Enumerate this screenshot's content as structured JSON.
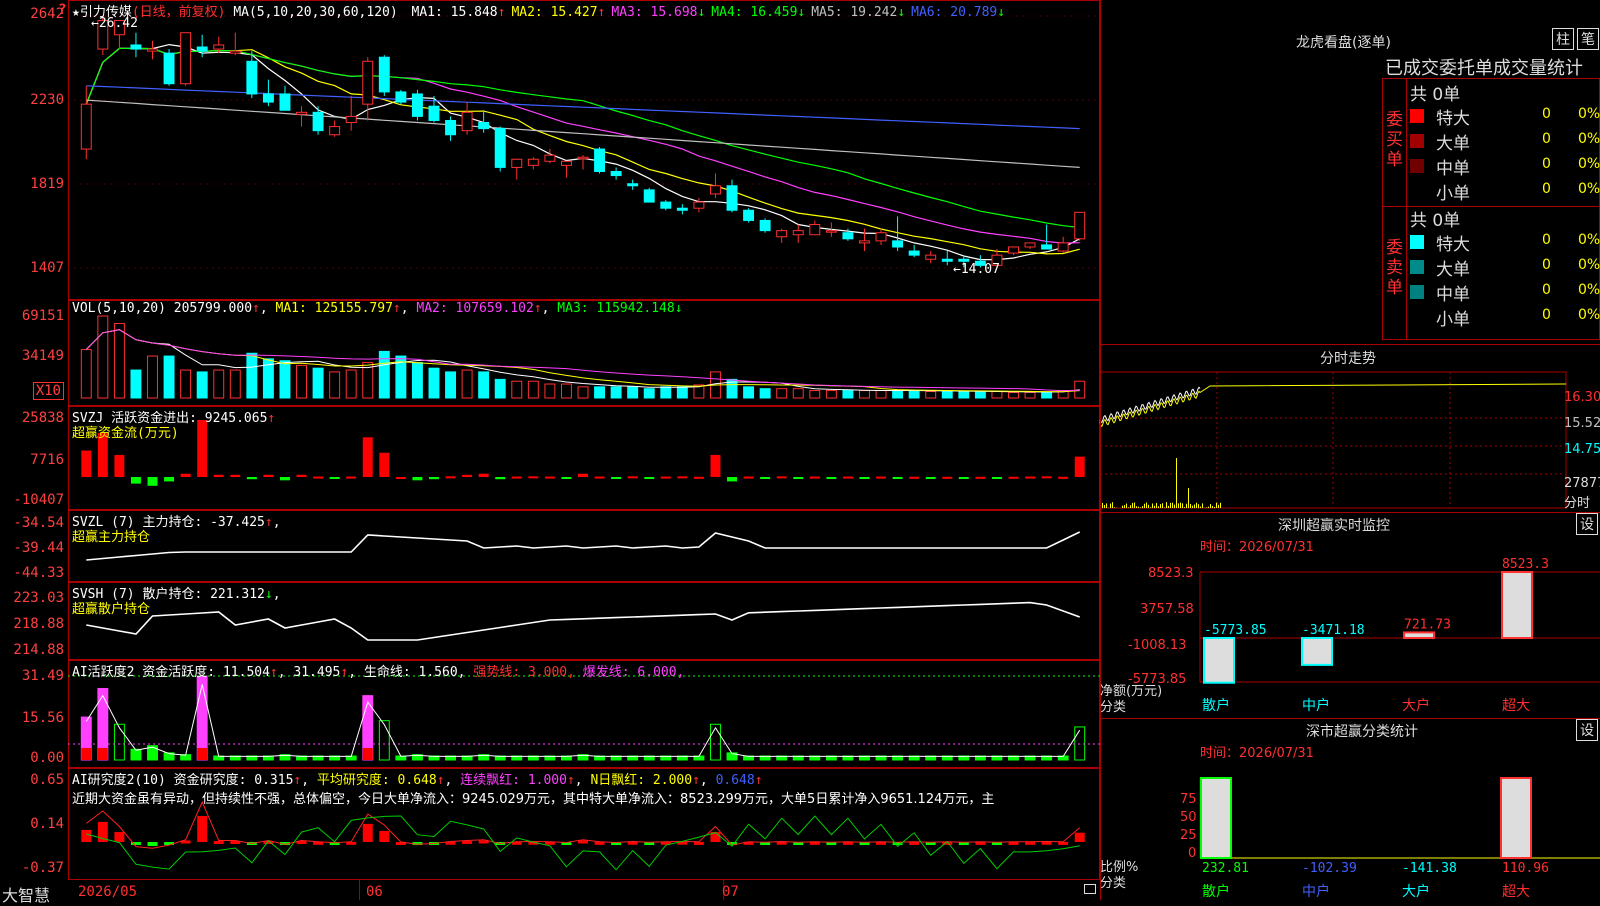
{
  "stock": {
    "name": "引力传媒",
    "mode": "(日线，前复权)",
    "ma_label": "MA(5,10,20,30,60,120)",
    "ma_values": [
      {
        "label": "MA1:",
        "value": "15.848",
        "arrow": "↑",
        "color": "#ffffff"
      },
      {
        "label": "MA2:",
        "value": "15.427",
        "arrow": "↑",
        "color": "#ffff00"
      },
      {
        "label": "MA3:",
        "value": "15.698",
        "arrow": "↓",
        "color": "#ff40ff"
      },
      {
        "label": "MA4:",
        "value": "16.459",
        "arrow": "↓",
        "color": "#00ff00"
      },
      {
        "label": "MA5:",
        "value": "19.242",
        "arrow": "↓",
        "color": "#c0c0c0"
      },
      {
        "label": "MA6:",
        "value": "20.789",
        "arrow": "↓",
        "color": "#4060ff"
      }
    ],
    "high_marker": "26.42",
    "low_marker": "14.07",
    "price_ticks": [
      "2642",
      "2230",
      "1819",
      "1407"
    ]
  },
  "vol": {
    "header": "VOL(5,10,20)",
    "value": "205799.000",
    "ma1": "MA1: 125155.797",
    "ma2": "MA2: 107659.102",
    "ma3": "MA3: 115942.148",
    "ticks": [
      "69151",
      "34149"
    ],
    "unit": "X10"
  },
  "svzj": {
    "header": "SVZJ  活跃资金进出: 9245.065",
    "sub": "超赢资金流(万元)",
    "ticks": [
      "25838",
      "7716",
      "-10407"
    ]
  },
  "svzl": {
    "header": "SVZL (7) 主力持仓: -37.425",
    "sub": "超赢主力持仓",
    "ticks": [
      "-34.54",
      "-39.44",
      "-44.33"
    ]
  },
  "svsh": {
    "header": "SVSH (7) 散户持仓: 221.312",
    "sub": "超赢散户持仓",
    "ticks": [
      "223.03",
      "218.88",
      "214.88"
    ]
  },
  "ai1": {
    "header": "AI活跃度2 资金活跃度: 11.504",
    "v2": "31.495",
    "life": "生命线: 1.560,",
    "strong": "强势线: 3.000,",
    "burst": "爆发线: 6.000,",
    "ticks": [
      "31.49",
      "15.56",
      "0.00"
    ]
  },
  "ai2": {
    "header": "AI研究度2(10) 资金研究度: 0.315",
    "avg": "平均研究度: 0.648",
    "cont": "连续飘红: 1.000",
    "nday": "N日飘红: 2.000",
    "last": "0.648",
    "text": "近期大资金虽有异动，但持续性不强，总体偏空，今日大单净流入：9245.029万元，其中特大单净流入：8523.299万元，大单5日累计净入9651.124万元，主",
    "ticks": [
      "0.65",
      "0.14",
      "-0.37"
    ]
  },
  "dates": [
    "2026/05",
    "06",
    "07"
  ],
  "logo": "大智慧",
  "right": {
    "title": "龙虎看盘(逐单)",
    "btn1": "柱",
    "btn2": "笔",
    "subtitle": "已成交委托单成交量统计",
    "buy_label": "委买单",
    "sell_label": "委卖单",
    "buy_total": "共 0单",
    "sell_total": "共 0单",
    "buy_rows": [
      {
        "name": "特大",
        "count": "0",
        "pct": "0%",
        "color": "#ff0000"
      },
      {
        "name": "大单",
        "count": "0",
        "pct": "0%",
        "color": "#a00000"
      },
      {
        "name": "中单",
        "count": "0",
        "pct": "0%",
        "color": "#700000"
      },
      {
        "name": "小单",
        "count": "0",
        "pct": "0%",
        "color": ""
      }
    ],
    "sell_rows": [
      {
        "name": "特大",
        "count": "0",
        "pct": "0%",
        "color": "#00ffff"
      },
      {
        "name": "大单",
        "count": "0",
        "pct": "0%",
        "color": "#008b8b"
      },
      {
        "name": "中单",
        "count": "0",
        "pct": "0%",
        "color": "#008080"
      },
      {
        "name": "小单",
        "count": "0",
        "pct": "0%",
        "color": ""
      }
    ],
    "intraday_title": "分时走势",
    "intraday_ticks": [
      "16.30",
      "15.52",
      "14.75",
      "27877",
      "分时"
    ],
    "monitor_title": "深圳超赢实时监控",
    "monitor_btn": "设",
    "monitor_time": "时间：2026/07/31",
    "monitor_ticks": [
      "8523.3",
      "3757.58",
      "-1008.13",
      "-5773.85"
    ],
    "monitor_axis": [
      "净额(万元)",
      "分类"
    ],
    "stat_title": "深市超赢分类统计",
    "stat_btn": "设",
    "stat_time": "时间：2026/07/31",
    "stat_ticks": [
      "75",
      "50",
      "25",
      "0"
    ],
    "stat_axis": [
      "比例%",
      "分类"
    ]
  },
  "chart_data": [
    {
      "type": "candlestick",
      "title": "引力传媒 (日线，前复权)",
      "ohlc": [
        [
          19.9,
          23.0,
          19.4,
          22.1
        ],
        [
          24.8,
          26.4,
          24.5,
          26.2
        ],
        [
          25.5,
          26.2,
          24.8,
          26.2
        ],
        [
          25.0,
          25.6,
          24.4,
          24.8
        ],
        [
          24.7,
          25.2,
          24.3,
          24.8
        ],
        [
          24.6,
          24.8,
          23.0,
          23.1
        ],
        [
          23.1,
          25.5,
          23.0,
          25.6
        ],
        [
          24.9,
          25.5,
          24.4,
          24.7
        ],
        [
          24.8,
          25.4,
          24.6,
          25.0
        ],
        [
          24.6,
          25.6,
          24.5,
          24.7
        ],
        [
          24.2,
          24.7,
          22.4,
          22.6
        ],
        [
          22.6,
          23.3,
          22.0,
          22.2
        ],
        [
          22.6,
          23.0,
          21.8,
          21.8
        ],
        [
          21.6,
          22.0,
          21.0,
          21.7
        ],
        [
          21.7,
          22.0,
          20.6,
          20.8
        ],
        [
          20.6,
          21.3,
          20.5,
          21.0
        ],
        [
          21.2,
          22.5,
          20.8,
          21.5
        ],
        [
          22.1,
          24.4,
          21.3,
          24.2
        ],
        [
          24.4,
          24.5,
          22.5,
          22.7
        ],
        [
          22.7,
          22.8,
          22.1,
          22.2
        ],
        [
          22.6,
          22.8,
          21.3,
          21.5
        ],
        [
          22.0,
          22.5,
          21.2,
          21.3
        ],
        [
          21.3,
          21.5,
          20.3,
          20.6
        ],
        [
          20.8,
          22.2,
          20.6,
          21.7
        ],
        [
          21.2,
          21.8,
          20.7,
          20.9
        ],
        [
          20.9,
          21.0,
          18.8,
          19.0
        ],
        [
          19.0,
          19.3,
          18.4,
          19.4
        ],
        [
          19.1,
          19.5,
          18.9,
          19.4
        ],
        [
          19.3,
          19.9,
          19.2,
          19.6
        ],
        [
          19.1,
          19.3,
          18.5,
          19.3
        ],
        [
          19.5,
          19.6,
          18.9,
          19.5
        ],
        [
          19.9,
          20.0,
          18.7,
          18.8
        ],
        [
          18.8,
          19.0,
          18.4,
          18.6
        ],
        [
          18.2,
          18.4,
          17.9,
          18.1
        ],
        [
          17.9,
          18.0,
          17.3,
          17.3
        ],
        [
          17.3,
          17.4,
          16.9,
          17.0
        ],
        [
          17.0,
          17.2,
          16.7,
          16.9
        ],
        [
          17.0,
          17.5,
          16.8,
          17.3
        ],
        [
          17.7,
          18.7,
          17.5,
          18.1
        ],
        [
          18.1,
          18.4,
          16.8,
          16.9
        ],
        [
          16.9,
          17.0,
          16.3,
          16.4
        ],
        [
          16.4,
          16.5,
          15.8,
          15.9
        ],
        [
          15.6,
          16.0,
          15.3,
          15.9
        ],
        [
          15.7,
          16.2,
          15.3,
          15.9
        ],
        [
          15.7,
          16.4,
          15.7,
          16.2
        ],
        [
          15.9,
          16.3,
          15.6,
          15.9
        ],
        [
          15.8,
          16.0,
          15.4,
          15.5
        ],
        [
          15.3,
          16.0,
          14.9,
          15.4
        ],
        [
          15.4,
          16.0,
          15.2,
          15.8
        ],
        [
          15.4,
          16.6,
          14.9,
          15.1
        ],
        [
          14.9,
          15.2,
          14.6,
          14.7
        ],
        [
          14.5,
          14.9,
          14.3,
          14.7
        ],
        [
          14.5,
          14.9,
          14.2,
          14.4
        ],
        [
          14.5,
          14.7,
          14.1,
          14.4
        ],
        [
          14.4,
          14.7,
          14.1,
          14.2
        ],
        [
          14.2,
          15.0,
          14.1,
          14.7
        ],
        [
          14.8,
          15.1,
          14.7,
          15.1
        ],
        [
          15.1,
          15.3,
          15.0,
          15.3
        ],
        [
          15.2,
          16.2,
          15.0,
          15.0
        ],
        [
          14.9,
          15.6,
          14.8,
          15.3
        ],
        [
          15.5,
          16.8,
          15.4,
          16.8
        ]
      ]
    },
    {
      "type": "bar",
      "title": "VOL",
      "values": [
        52,
        88,
        80,
        30,
        45,
        45,
        30,
        28,
        30,
        30,
        48,
        42,
        40,
        35,
        32,
        28,
        30,
        38,
        50,
        45,
        38,
        32,
        28,
        30,
        28,
        20,
        18,
        18,
        15,
        15,
        12,
        12,
        12,
        12,
        10,
        12,
        12,
        14,
        28,
        20,
        12,
        10,
        10,
        10,
        8,
        8,
        8,
        8,
        8,
        8,
        8,
        7,
        7,
        7,
        7,
        7,
        6,
        6,
        6,
        8,
        18
      ]
    },
    {
      "type": "bar",
      "title": "超赢资金流(万元)",
      "values": [
        12000,
        20000,
        10000,
        -3000,
        -4000,
        -2000,
        1500,
        25838,
        1000,
        1000,
        -1000,
        1000,
        -1500,
        1000,
        200,
        -500,
        200,
        18000,
        11000,
        0,
        -1500,
        -1000,
        300,
        1000,
        1500,
        -1000,
        200,
        300,
        200,
        -300,
        1500,
        200,
        -300,
        300,
        -200,
        200,
        300,
        100,
        10000,
        -2000,
        200,
        -200,
        300,
        -200,
        200,
        -200,
        200,
        -100,
        200,
        -100,
        100,
        -100,
        100,
        -100,
        100,
        -100,
        100,
        200,
        300,
        100,
        9245
      ]
    }
  ]
}
